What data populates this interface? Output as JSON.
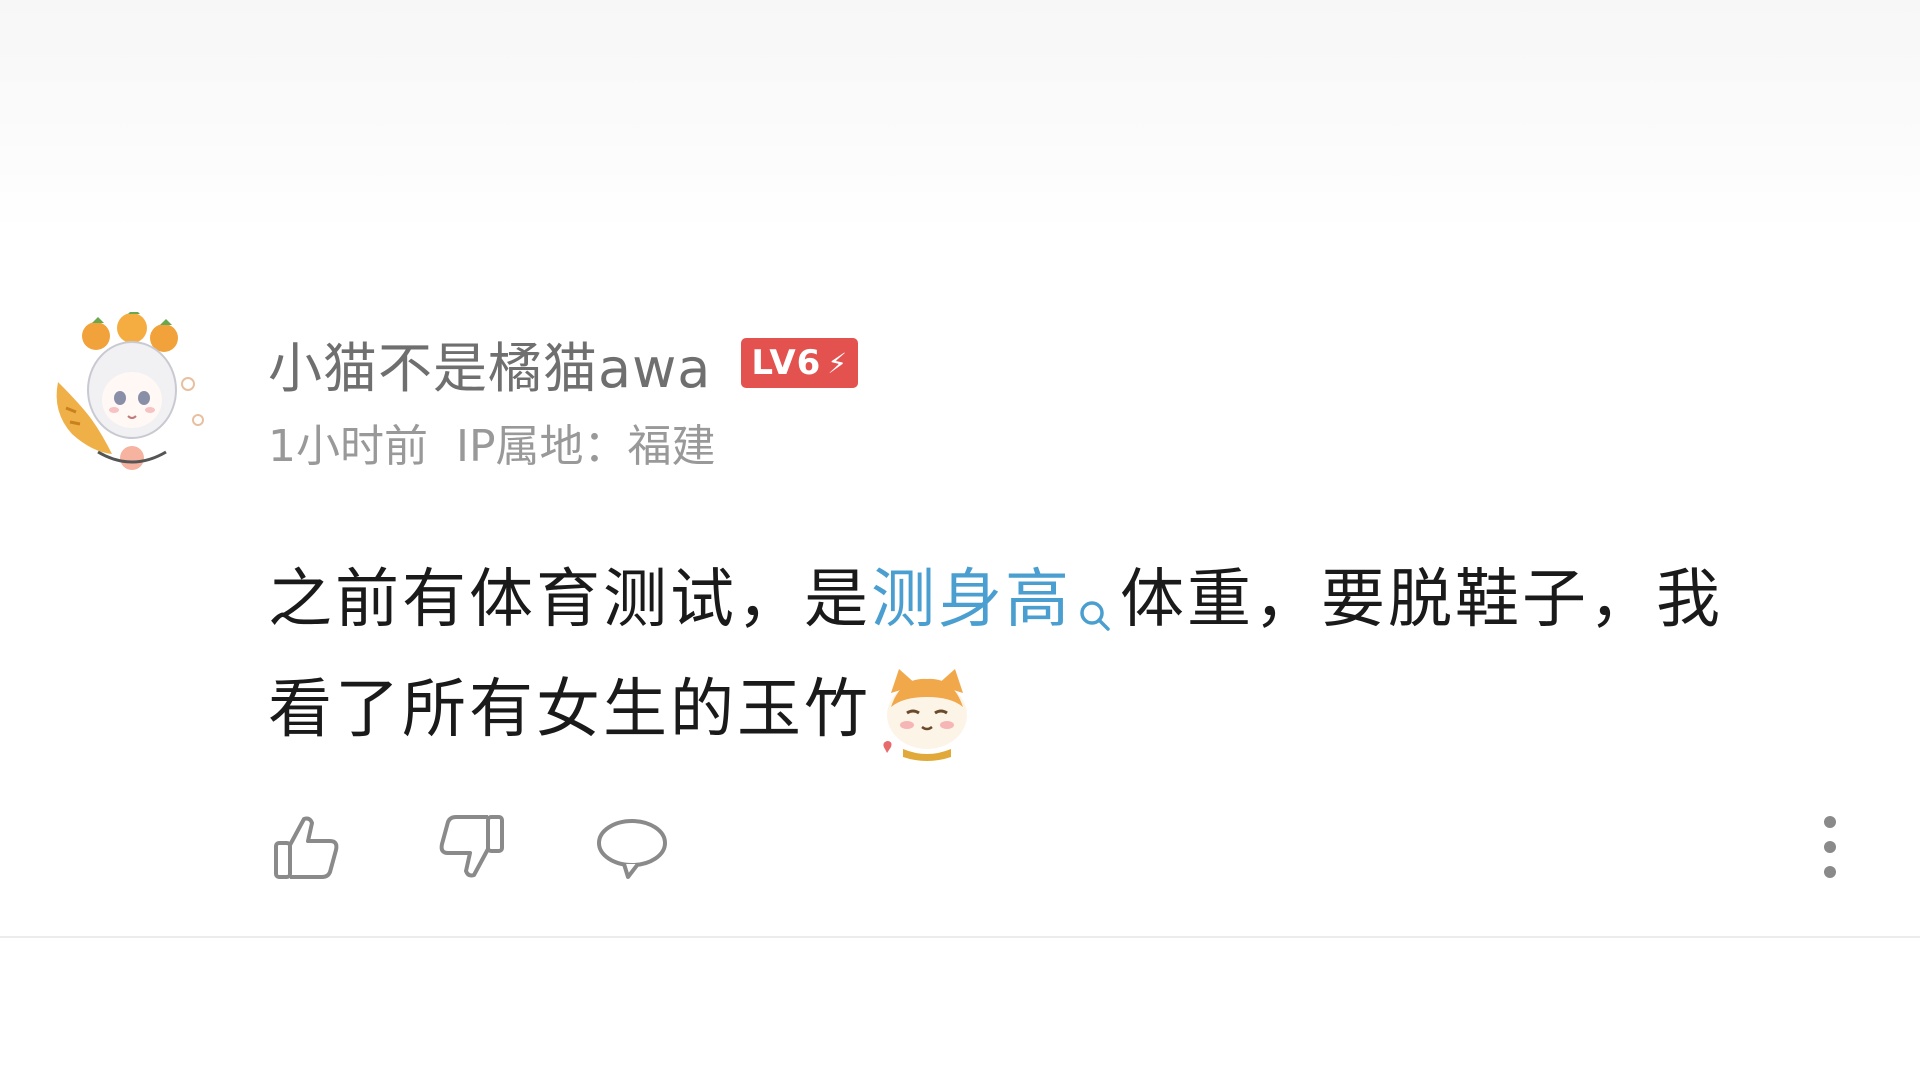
{
  "comment": {
    "username": "小猫不是橘猫awa",
    "level": "LV6",
    "time": "1小时前",
    "ip_label": "IP属地：",
    "ip_location": "福建",
    "content": {
      "part1": "之前有体育测试，是",
      "link": "测身高",
      "part2": "体重，要脱鞋子，我",
      "line2": "看了所有女生的玉竹"
    },
    "avatar_icon": "anime-girl-with-oranges-avatar",
    "emoji_icon": "shy-cat-emoji",
    "actions": {
      "like_icon": "thumbs-up-icon",
      "dislike_icon": "thumbs-down-icon",
      "reply_icon": "comment-bubble-icon",
      "more_icon": "more-vertical-icon"
    },
    "colors": {
      "level_badge": "#e3524f",
      "link": "#4a9fd0",
      "username": "#6f6f6f",
      "meta": "#999999"
    }
  }
}
